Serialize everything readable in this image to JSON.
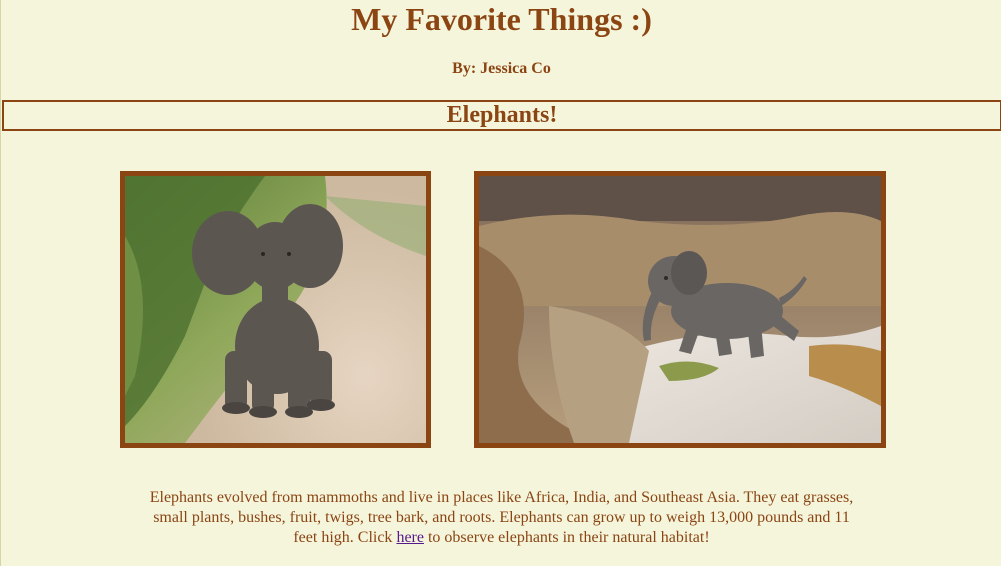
{
  "page": {
    "title": "My Favorite Things :)",
    "byline": "By: Jessica Co"
  },
  "section": {
    "heading": "Elephants!"
  },
  "photos": [
    {
      "name": "baby-elephant-standing-photo"
    },
    {
      "name": "baby-elephant-running-photo"
    }
  ],
  "description": {
    "text_before_link": "Elephants evolved from mammoths and live in places like Africa, India, and Southeast Asia. They eat grasses, small plants, bushes, fruit, twigs, tree bark, and roots. Elephants can grow up to weigh 13,000 pounds and 11 feet high. Click ",
    "link_text": "here",
    "text_after_link": " to observe elephants in their natural habitat!"
  },
  "colors": {
    "background": "#f5f5dc",
    "text": "#8b4513",
    "border": "#8b4513",
    "link": "#551a8b"
  }
}
